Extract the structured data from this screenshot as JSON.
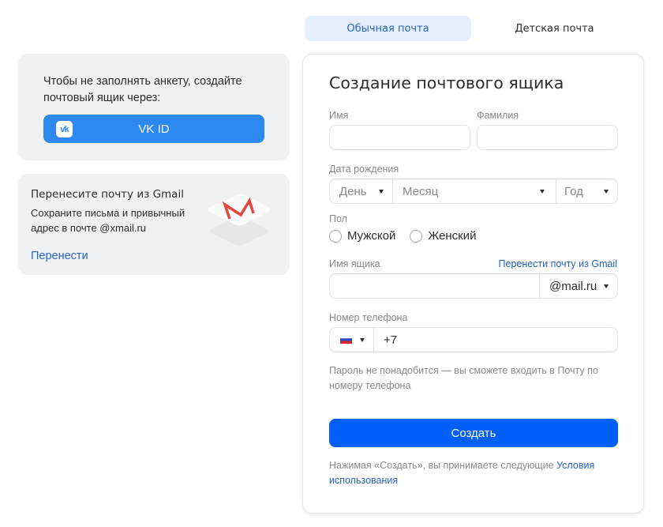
{
  "tabs": [
    {
      "label": "Обычная почта",
      "active": true
    },
    {
      "label": "Детская почта",
      "active": false
    }
  ],
  "vk_card": {
    "text": "Чтобы не заполнять анкету, создайте почтовый ящик через:",
    "button_label": "VK ID",
    "logo_text": "vk"
  },
  "gmail_card": {
    "title": "Перенесите почту из Gmail",
    "description": "Сохраните письма и привычный адрес в почте @xmail.ru",
    "link": "Перенести"
  },
  "form": {
    "title": "Создание почтового ящика",
    "first_name": {
      "label": "Имя",
      "value": ""
    },
    "last_name": {
      "label": "Фамилия",
      "value": ""
    },
    "birth_date": {
      "label": "Дата рождения",
      "day": "День",
      "month": "Месяц",
      "year": "Год"
    },
    "gender": {
      "label": "Пол",
      "options": [
        "Мужской",
        "Женский"
      ]
    },
    "mailbox": {
      "label": "Имя ящика",
      "gmail_link": "Перенести почту из Gmail",
      "value": "",
      "domain": "@mail.ru"
    },
    "phone": {
      "label": "Номер телефона",
      "country": "RU",
      "value": "+7"
    },
    "password_hint": "Пароль не понадобится — вы сможете входить в Почту по номеру телефона",
    "submit_label": "Создать",
    "terms_text": "Нажимая «Создать», вы принимаете следующие ",
    "terms_link": "Условия использования"
  },
  "colors": {
    "primary": "#005ff9",
    "vk_blue": "#2d88f0",
    "link": "#2764c4",
    "tab_active_bg": "#e5effd",
    "gmail_red": "#e2483d"
  }
}
